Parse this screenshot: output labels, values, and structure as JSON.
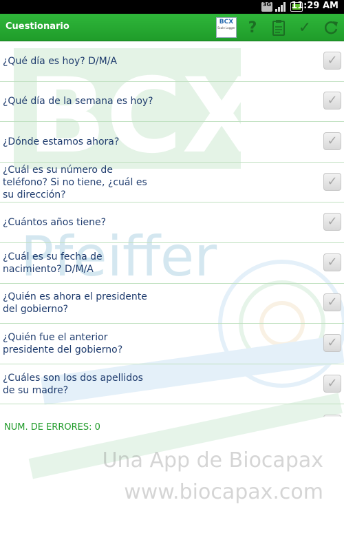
{
  "status_bar": {
    "network": "3G",
    "time": "11:29 AM"
  },
  "action_bar": {
    "title": "Cuestionario",
    "logo": "BCX",
    "logo_sub": "Scale Logger",
    "help": "?",
    "check": "✓"
  },
  "questions": [
    {
      "text": "¿Qué día es hoy? D/M/A"
    },
    {
      "text": "¿Qué día de la semana es hoy?"
    },
    {
      "text": "¿Dónde estamos ahora?"
    },
    {
      "text": "¿Cuál es su número de teléfono? Si no tiene, ¿cuál es su dirección?"
    },
    {
      "text": "¿Cuántos años tiene?"
    },
    {
      "text": "¿Cuál es su fecha de nacimiento? D/M/A"
    },
    {
      "text": "¿Quién es ahora el presidente del gobierno?"
    },
    {
      "text": "¿Quién fue el anterior presidente del gobierno?"
    },
    {
      "text": "¿Cuáles son los dos apellidos de su madre?"
    }
  ],
  "check_glyph": "✓",
  "footer": {
    "errors_label": "NUM. DE ERRORES: 0"
  },
  "watermark": {
    "brand": "BCX",
    "company": "Pfeiffer",
    "tagline": "Una App de Biocapax",
    "website": "www.biocapax.com"
  }
}
